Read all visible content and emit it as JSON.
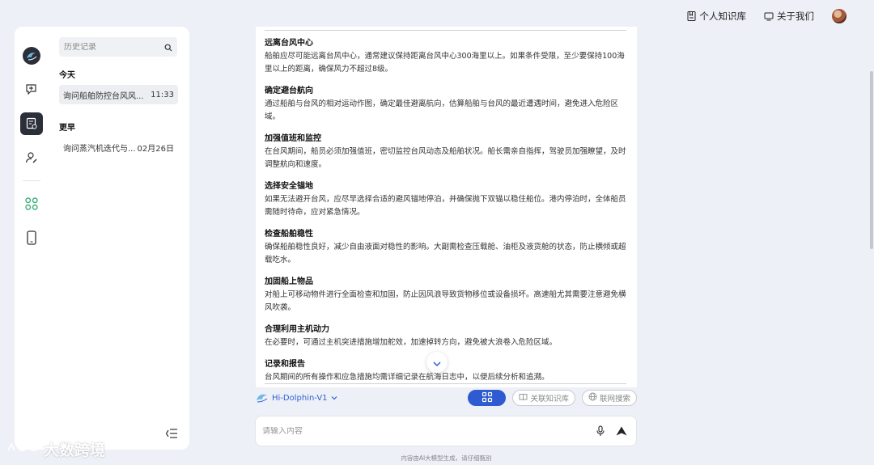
{
  "topbar": {
    "knowledge_label": "个人知识库",
    "about_label": "关于我们"
  },
  "rail": {
    "items": [
      "logo",
      "new-chat",
      "chat-history",
      "user-edit",
      "apps",
      "mobile"
    ]
  },
  "history": {
    "search_placeholder": "历史记录",
    "groups": [
      {
        "title": "今天",
        "items": [
          {
            "title": "询问船舶防控台风风...",
            "time": "11:33"
          }
        ]
      },
      {
        "title": "更早",
        "items": [
          {
            "title": "询问蒸汽机迭代与...",
            "time": "02月26日"
          }
        ]
      }
    ]
  },
  "content": {
    "sections": [
      {
        "title": "远离台风中心",
        "body": "船舶应尽可能远离台风中心，通常建议保持距离台风中心300海里以上。如果条件受限，至少要保持100海里以上的距离，确保风力不超过8级。"
      },
      {
        "title": "确定避台航向",
        "body": "通过船舶与台风的相对运动作图，确定最佳避离航向，估算船舶与台风的最近遭遇时间，避免进入危险区域。"
      },
      {
        "title": "加强值班和监控",
        "body": "在台风期间，船员必须加强值班，密切监控台风动态及船舶状况。船长需亲自指挥，驾驶员加强瞭望，及时调整航向和速度。"
      },
      {
        "title": "选择安全锚地",
        "body": "如果无法避开台风，应尽早选择合适的避风锚地停泊，并确保抛下双锚以稳住船位。港内停泊时，全体船员需随时待命，应对紧急情况。"
      },
      {
        "title": "检查船舶稳性",
        "body": "确保船舶稳性良好，减少自由液面对稳性的影响。大副需检查压载舱、油柜及液货舱的状态，防止横倾或超载吃水。"
      },
      {
        "title": "加固船上物品",
        "body": "对船上可移动物件进行全面检查和加固，防止因风浪导致货物移位或设备损坏。高速船尤其需要注意避免横风吹袭。"
      },
      {
        "title": "合理利用主机动力",
        "body": "在必要时，可通过主机突进措施增加舵效，加速掉转方向，避免被大浪卷入危险区域。"
      },
      {
        "title": "记录和报告",
        "body": "台风期间的所有操作和应急措施均需详细记录在航海日志中，以便后续分析和追溯。"
      }
    ]
  },
  "modelbar": {
    "model_name": "Hi-Dolphin-V1",
    "knowledge_label": "关联知识库",
    "web_search_label": "联网搜索"
  },
  "input": {
    "placeholder": "请输入内容"
  },
  "disclaimer": "内容由AI大模型生成，请仔细甄别",
  "watermark": "大数跨境",
  "colors": {
    "accent": "#2e5bd1",
    "rail_active": "#2b2f3a",
    "background": "#eef0f7"
  }
}
